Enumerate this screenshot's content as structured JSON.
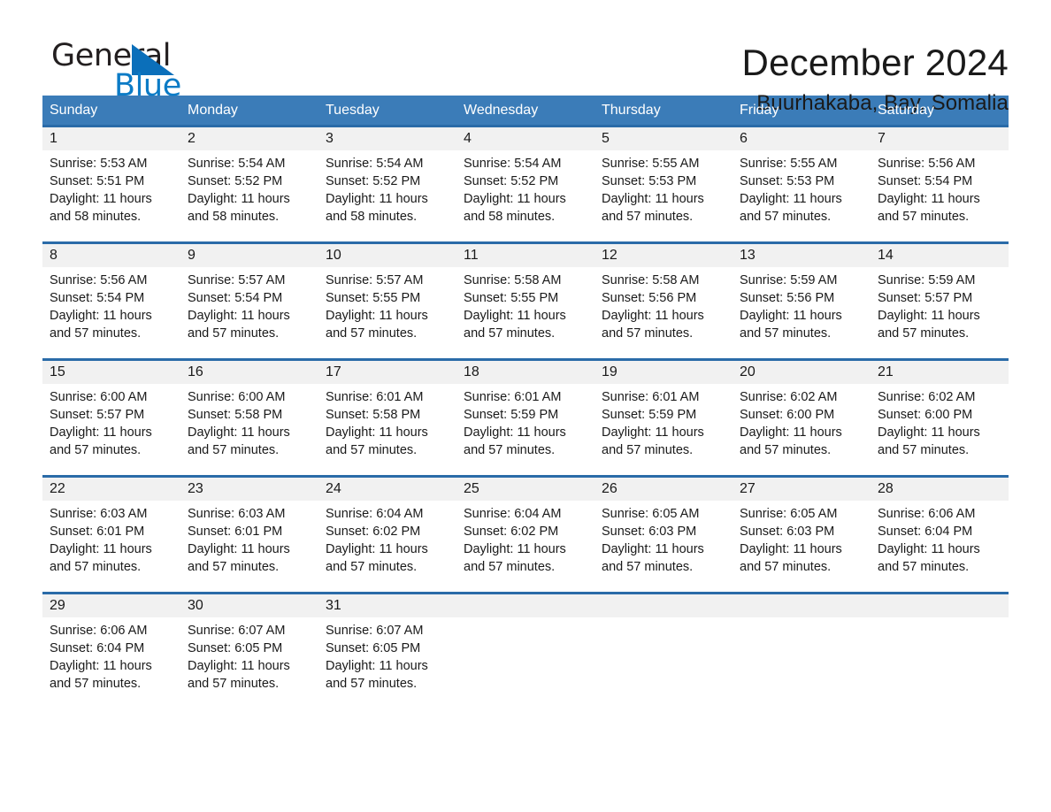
{
  "logo": {
    "word_one": "General",
    "word_two": "Blue",
    "triangle_icon": "triangle-icon",
    "brand_blue": "#0b7bc6",
    "triangle_blue": "#0b6fba"
  },
  "header": {
    "title": "December 2024",
    "location": "Buurhakaba, Bay, Somalia"
  },
  "calendar": {
    "header_bg": "#3b7cb8",
    "row_divider": "#2a6ba8",
    "day_number_bg": "#f1f1f1",
    "weekdays": [
      "Sunday",
      "Monday",
      "Tuesday",
      "Wednesday",
      "Thursday",
      "Friday",
      "Saturday"
    ],
    "weeks": [
      [
        {
          "day": "1",
          "sunrise": "Sunrise: 5:53 AM",
          "sunset": "Sunset: 5:51 PM",
          "daylight": "Daylight: 11 hours and 58 minutes."
        },
        {
          "day": "2",
          "sunrise": "Sunrise: 5:54 AM",
          "sunset": "Sunset: 5:52 PM",
          "daylight": "Daylight: 11 hours and 58 minutes."
        },
        {
          "day": "3",
          "sunrise": "Sunrise: 5:54 AM",
          "sunset": "Sunset: 5:52 PM",
          "daylight": "Daylight: 11 hours and 58 minutes."
        },
        {
          "day": "4",
          "sunrise": "Sunrise: 5:54 AM",
          "sunset": "Sunset: 5:52 PM",
          "daylight": "Daylight: 11 hours and 58 minutes."
        },
        {
          "day": "5",
          "sunrise": "Sunrise: 5:55 AM",
          "sunset": "Sunset: 5:53 PM",
          "daylight": "Daylight: 11 hours and 57 minutes."
        },
        {
          "day": "6",
          "sunrise": "Sunrise: 5:55 AM",
          "sunset": "Sunset: 5:53 PM",
          "daylight": "Daylight: 11 hours and 57 minutes."
        },
        {
          "day": "7",
          "sunrise": "Sunrise: 5:56 AM",
          "sunset": "Sunset: 5:54 PM",
          "daylight": "Daylight: 11 hours and 57 minutes."
        }
      ],
      [
        {
          "day": "8",
          "sunrise": "Sunrise: 5:56 AM",
          "sunset": "Sunset: 5:54 PM",
          "daylight": "Daylight: 11 hours and 57 minutes."
        },
        {
          "day": "9",
          "sunrise": "Sunrise: 5:57 AM",
          "sunset": "Sunset: 5:54 PM",
          "daylight": "Daylight: 11 hours and 57 minutes."
        },
        {
          "day": "10",
          "sunrise": "Sunrise: 5:57 AM",
          "sunset": "Sunset: 5:55 PM",
          "daylight": "Daylight: 11 hours and 57 minutes."
        },
        {
          "day": "11",
          "sunrise": "Sunrise: 5:58 AM",
          "sunset": "Sunset: 5:55 PM",
          "daylight": "Daylight: 11 hours and 57 minutes."
        },
        {
          "day": "12",
          "sunrise": "Sunrise: 5:58 AM",
          "sunset": "Sunset: 5:56 PM",
          "daylight": "Daylight: 11 hours and 57 minutes."
        },
        {
          "day": "13",
          "sunrise": "Sunrise: 5:59 AM",
          "sunset": "Sunset: 5:56 PM",
          "daylight": "Daylight: 11 hours and 57 minutes."
        },
        {
          "day": "14",
          "sunrise": "Sunrise: 5:59 AM",
          "sunset": "Sunset: 5:57 PM",
          "daylight": "Daylight: 11 hours and 57 minutes."
        }
      ],
      [
        {
          "day": "15",
          "sunrise": "Sunrise: 6:00 AM",
          "sunset": "Sunset: 5:57 PM",
          "daylight": "Daylight: 11 hours and 57 minutes."
        },
        {
          "day": "16",
          "sunrise": "Sunrise: 6:00 AM",
          "sunset": "Sunset: 5:58 PM",
          "daylight": "Daylight: 11 hours and 57 minutes."
        },
        {
          "day": "17",
          "sunrise": "Sunrise: 6:01 AM",
          "sunset": "Sunset: 5:58 PM",
          "daylight": "Daylight: 11 hours and 57 minutes."
        },
        {
          "day": "18",
          "sunrise": "Sunrise: 6:01 AM",
          "sunset": "Sunset: 5:59 PM",
          "daylight": "Daylight: 11 hours and 57 minutes."
        },
        {
          "day": "19",
          "sunrise": "Sunrise: 6:01 AM",
          "sunset": "Sunset: 5:59 PM",
          "daylight": "Daylight: 11 hours and 57 minutes."
        },
        {
          "day": "20",
          "sunrise": "Sunrise: 6:02 AM",
          "sunset": "Sunset: 6:00 PM",
          "daylight": "Daylight: 11 hours and 57 minutes."
        },
        {
          "day": "21",
          "sunrise": "Sunrise: 6:02 AM",
          "sunset": "Sunset: 6:00 PM",
          "daylight": "Daylight: 11 hours and 57 minutes."
        }
      ],
      [
        {
          "day": "22",
          "sunrise": "Sunrise: 6:03 AM",
          "sunset": "Sunset: 6:01 PM",
          "daylight": "Daylight: 11 hours and 57 minutes."
        },
        {
          "day": "23",
          "sunrise": "Sunrise: 6:03 AM",
          "sunset": "Sunset: 6:01 PM",
          "daylight": "Daylight: 11 hours and 57 minutes."
        },
        {
          "day": "24",
          "sunrise": "Sunrise: 6:04 AM",
          "sunset": "Sunset: 6:02 PM",
          "daylight": "Daylight: 11 hours and 57 minutes."
        },
        {
          "day": "25",
          "sunrise": "Sunrise: 6:04 AM",
          "sunset": "Sunset: 6:02 PM",
          "daylight": "Daylight: 11 hours and 57 minutes."
        },
        {
          "day": "26",
          "sunrise": "Sunrise: 6:05 AM",
          "sunset": "Sunset: 6:03 PM",
          "daylight": "Daylight: 11 hours and 57 minutes."
        },
        {
          "day": "27",
          "sunrise": "Sunrise: 6:05 AM",
          "sunset": "Sunset: 6:03 PM",
          "daylight": "Daylight: 11 hours and 57 minutes."
        },
        {
          "day": "28",
          "sunrise": "Sunrise: 6:06 AM",
          "sunset": "Sunset: 6:04 PM",
          "daylight": "Daylight: 11 hours and 57 minutes."
        }
      ],
      [
        {
          "day": "29",
          "sunrise": "Sunrise: 6:06 AM",
          "sunset": "Sunset: 6:04 PM",
          "daylight": "Daylight: 11 hours and 57 minutes."
        },
        {
          "day": "30",
          "sunrise": "Sunrise: 6:07 AM",
          "sunset": "Sunset: 6:05 PM",
          "daylight": "Daylight: 11 hours and 57 minutes."
        },
        {
          "day": "31",
          "sunrise": "Sunrise: 6:07 AM",
          "sunset": "Sunset: 6:05 PM",
          "daylight": "Daylight: 11 hours and 57 minutes."
        },
        {
          "day": "",
          "sunrise": "",
          "sunset": "",
          "daylight": ""
        },
        {
          "day": "",
          "sunrise": "",
          "sunset": "",
          "daylight": ""
        },
        {
          "day": "",
          "sunrise": "",
          "sunset": "",
          "daylight": ""
        },
        {
          "day": "",
          "sunrise": "",
          "sunset": "",
          "daylight": ""
        }
      ]
    ]
  }
}
